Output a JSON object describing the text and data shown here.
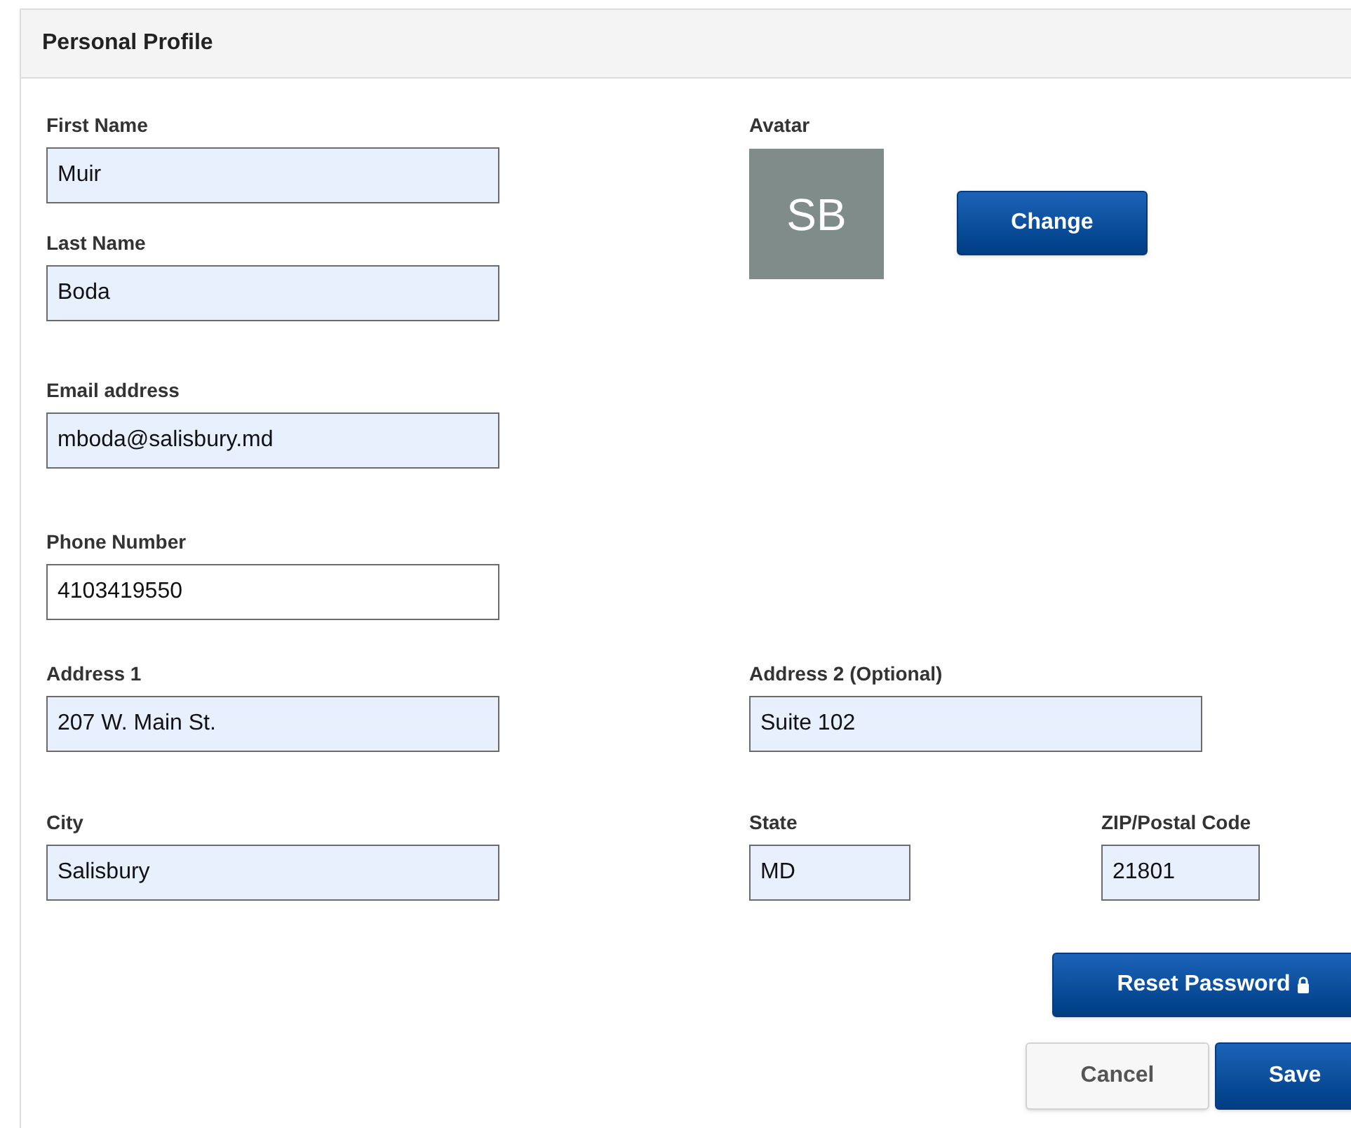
{
  "panel": {
    "title": "Personal Profile"
  },
  "fields": [
    {
      "label": "First Name",
      "value": "Muir",
      "autofilled": true
    },
    {
      "label": "Last Name",
      "value": "Boda",
      "autofilled": true
    },
    {
      "label": "Email address",
      "value": "mboda@salisbury.md",
      "autofilled": true
    },
    {
      "label": "Phone Number",
      "value": "4103419550",
      "autofilled": false
    },
    {
      "label": "Address 1",
      "value": "207 W. Main St.",
      "autofilled": true
    },
    {
      "label": "Address 2 (Optional)",
      "value": "Suite 102",
      "autofilled": true
    },
    {
      "label": "City",
      "value": "Salisbury",
      "autofilled": true
    },
    {
      "label": "State",
      "value": "MD",
      "autofilled": true
    },
    {
      "label": "ZIP/Postal Code",
      "value": "21801",
      "autofilled": true
    }
  ],
  "avatar": {
    "label": "Avatar",
    "initials": "SB"
  },
  "buttons": [
    {
      "label": "Change",
      "kind": "primary"
    },
    {
      "label": "Reset Password",
      "kind": "primary"
    },
    {
      "label": "Cancel",
      "kind": "secondary"
    },
    {
      "label": "Save",
      "kind": "primary"
    }
  ]
}
